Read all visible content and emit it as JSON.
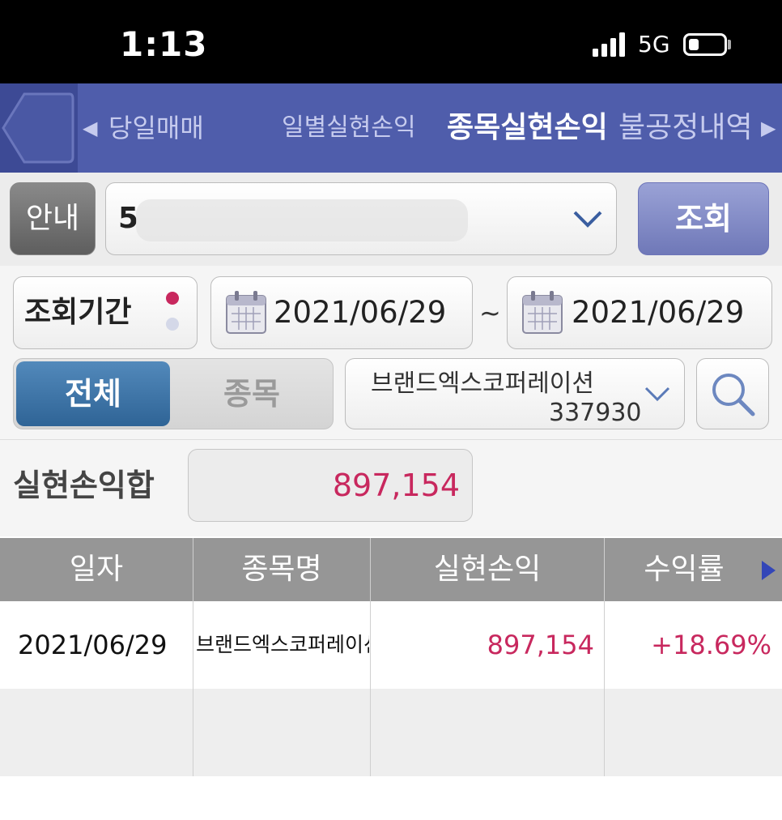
{
  "status_bar": {
    "time": "1:13",
    "network": "5G"
  },
  "tabs": {
    "prev_arrow": "◀",
    "next_arrow": "▶",
    "items": [
      {
        "label": "당일매매"
      },
      {
        "label": "일별실현손익"
      },
      {
        "label": "종목실현손익"
      },
      {
        "label": "불공정내역"
      }
    ],
    "active_index": 2
  },
  "account": {
    "guide_label": "안내",
    "account_prefix": "5",
    "query_label": "조회"
  },
  "period": {
    "label": "조회기간",
    "start_date": "2021/06/29",
    "separator": "~",
    "end_date": "2021/06/29"
  },
  "filter": {
    "all_label": "전체",
    "stock_label": "종목",
    "stock_name": "브랜드엑스코퍼레이션",
    "stock_code": "337930"
  },
  "summary": {
    "label": "실현손익합",
    "value": "897,154"
  },
  "table": {
    "headers": [
      "일자",
      "종목명",
      "실현손익",
      "수익률"
    ],
    "rows": [
      {
        "date": "2021/06/29",
        "name": "브랜드엑스코퍼레이션",
        "pnl": "897,154",
        "rate": "+18.69%"
      }
    ]
  },
  "colors": {
    "tab_bar": "#4f5dab",
    "accent_red": "#c8285e",
    "segment_active": "#3b6f9f",
    "query_button": "#7f88c6"
  }
}
